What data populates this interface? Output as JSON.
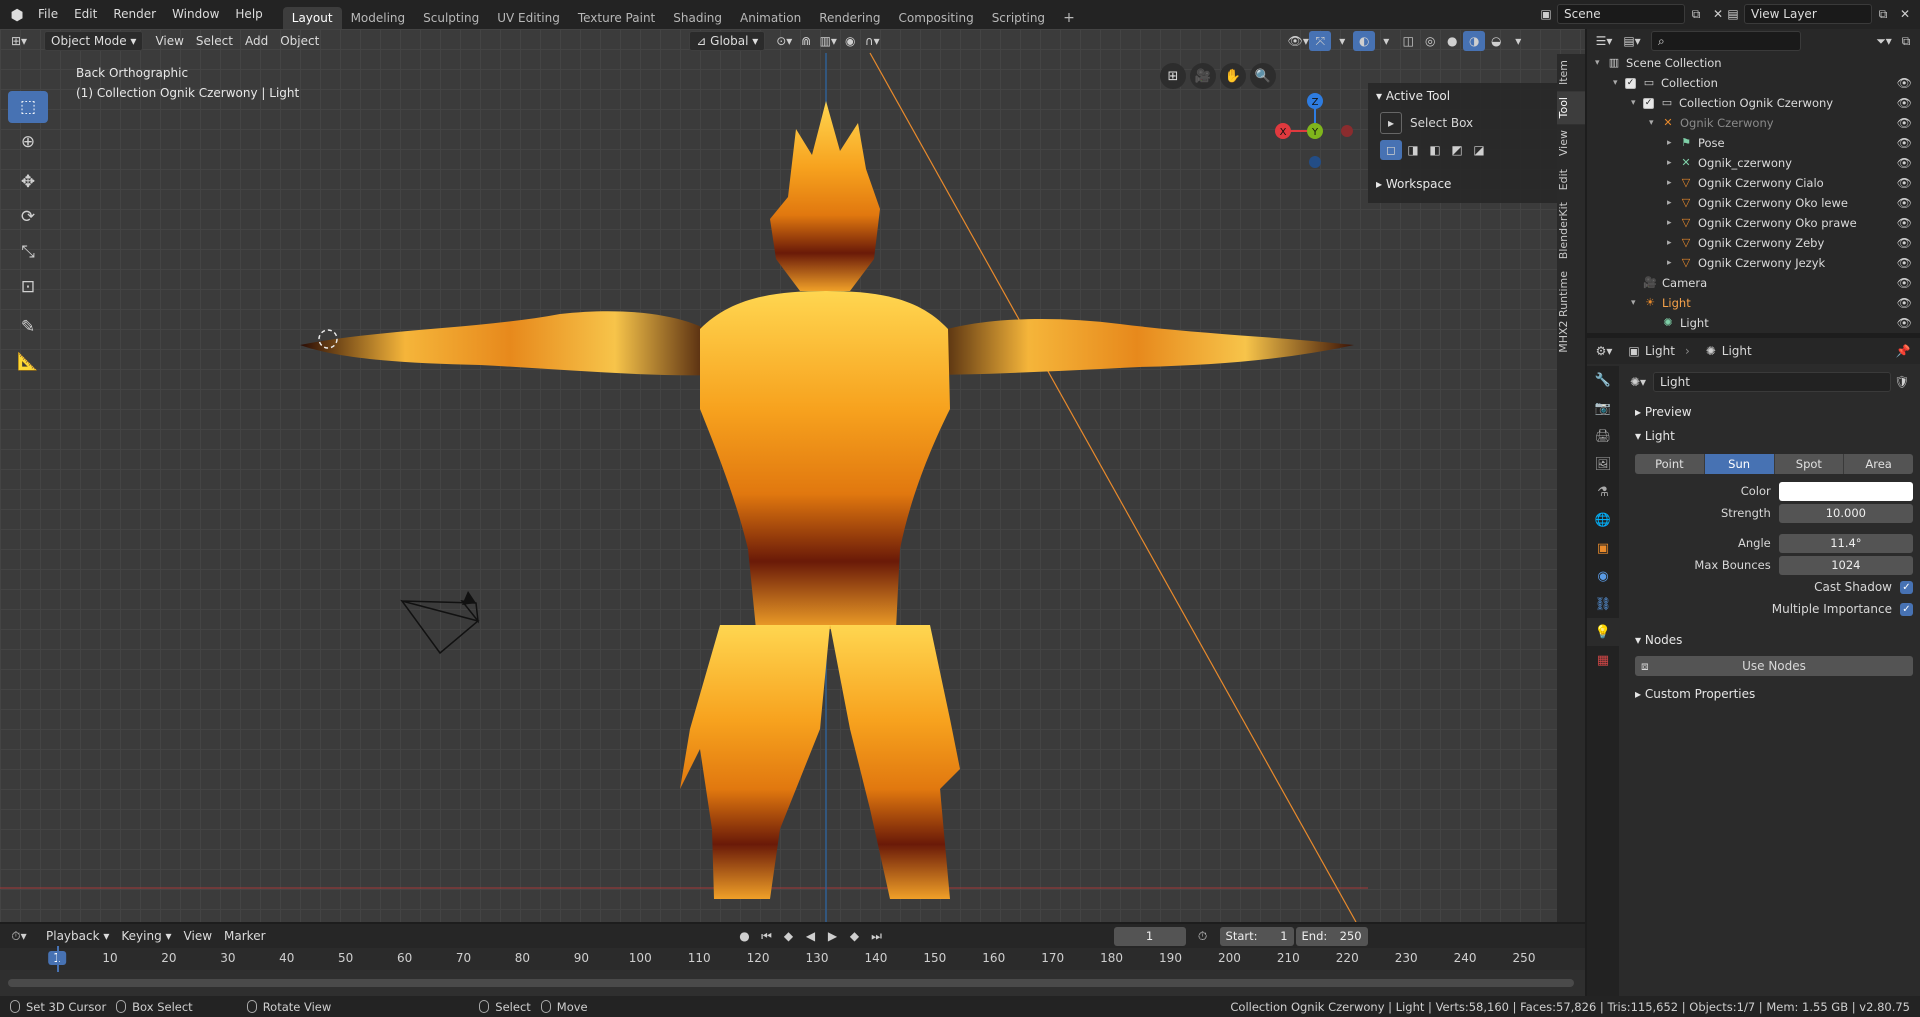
{
  "topbar": {
    "menus": [
      "File",
      "Edit",
      "Render",
      "Window",
      "Help"
    ],
    "workspaces": [
      "Layout",
      "Modeling",
      "Sculpting",
      "UV Editing",
      "Texture Paint",
      "Shading",
      "Animation",
      "Rendering",
      "Compositing",
      "Scripting"
    ],
    "active_workspace": "Layout",
    "scene_name": "Scene",
    "view_layer": "View Layer"
  },
  "viewport": {
    "mode": "Object Mode",
    "menus": [
      "View",
      "Select",
      "Add",
      "Object"
    ],
    "orientation": "Global",
    "view_name": "Back Orthographic",
    "view_context": "(1) Collection Ognik Czerwony | Light",
    "gizmo_axes": [
      "X",
      "Y",
      "Z"
    ]
  },
  "npanel": {
    "active_tool_header": "Active Tool",
    "tool_name": "Select Box",
    "workspace_header": "Workspace",
    "tabs": [
      "Item",
      "Tool",
      "View",
      "Edit",
      "BlenderKit",
      "MHX2 Runtime"
    ],
    "active_tab": "Tool"
  },
  "outliner": {
    "search_placeholder": "",
    "rows": [
      {
        "label": "Scene Collection",
        "indent": 0,
        "icon": "scene-collection-icon"
      },
      {
        "label": "Collection",
        "indent": 1,
        "icon": "collection-icon"
      },
      {
        "label": "Collection Ognik Czerwony",
        "indent": 2,
        "icon": "collection-icon"
      },
      {
        "label": "Ognik Czerwony",
        "indent": 3,
        "icon": "armature-icon"
      },
      {
        "label": "Pose",
        "indent": 4,
        "icon": "pose-icon"
      },
      {
        "label": "Ognik_czerwony",
        "indent": 4,
        "icon": "armature-data-icon"
      },
      {
        "label": "Ognik Czerwony Cialo",
        "indent": 4,
        "icon": "mesh-icon"
      },
      {
        "label": "Ognik Czerwony Oko lewe",
        "indent": 4,
        "icon": "mesh-icon"
      },
      {
        "label": "Ognik Czerwony Oko prawe",
        "indent": 4,
        "icon": "mesh-icon"
      },
      {
        "label": "Ognik Czerwony Zeby",
        "indent": 4,
        "icon": "mesh-icon"
      },
      {
        "label": "Ognik Czerwony Jezyk",
        "indent": 4,
        "icon": "mesh-icon"
      },
      {
        "label": "Camera",
        "indent": 2,
        "icon": "camera-icon"
      },
      {
        "label": "Light",
        "indent": 2,
        "icon": "light-icon"
      },
      {
        "label": "Light",
        "indent": 3,
        "icon": "light-data-icon"
      }
    ]
  },
  "properties": {
    "breadcrumb_object": "Light",
    "breadcrumb_data": "Light",
    "datablock_name": "Light",
    "sections": {
      "preview": "Preview",
      "light": "Light",
      "nodes": "Nodes",
      "custom": "Custom Properties"
    },
    "light_types": [
      "Point",
      "Sun",
      "Spot",
      "Area"
    ],
    "active_type": "Sun",
    "color_label": "Color",
    "color_value": "#ffffff",
    "strength_label": "Strength",
    "strength": "10.000",
    "angle_label": "Angle",
    "angle": "11.4°",
    "max_bounces_label": "Max Bounces",
    "max_bounces": "1024",
    "cast_shadow_label": "Cast Shadow",
    "multiple_importance_label": "Multiple Importance",
    "use_nodes_label": "Use Nodes"
  },
  "timeline": {
    "menus": [
      "Playback",
      "Keying",
      "View",
      "Marker"
    ],
    "current_frame": "1",
    "start_label": "Start:",
    "start": "1",
    "end_label": "End:",
    "end": "250",
    "ruler": [
      "1",
      "10",
      "20",
      "30",
      "40",
      "50",
      "60",
      "70",
      "80",
      "90",
      "100",
      "110",
      "120",
      "130",
      "140",
      "150",
      "160",
      "170",
      "180",
      "190",
      "200",
      "210",
      "220",
      "230",
      "240",
      "250"
    ]
  },
  "statusbar": {
    "hint1": "Set 3D Cursor",
    "hint2": "Box Select",
    "hint3": "Rotate View",
    "hint4": "Select",
    "hint5": "Move",
    "stats": "Collection Ognik Czerwony | Light | Verts:58,160 | Faces:57,826 | Tris:115,652 | Objects:1/7 | Mem: 1.55 GB | v2.80.75"
  },
  "colors": {
    "accent": "#4772b3",
    "light_orange": "#e88a2c",
    "x_axis": "#e0393e",
    "y_axis": "#7fb51c",
    "z_axis": "#2e7ce0"
  }
}
